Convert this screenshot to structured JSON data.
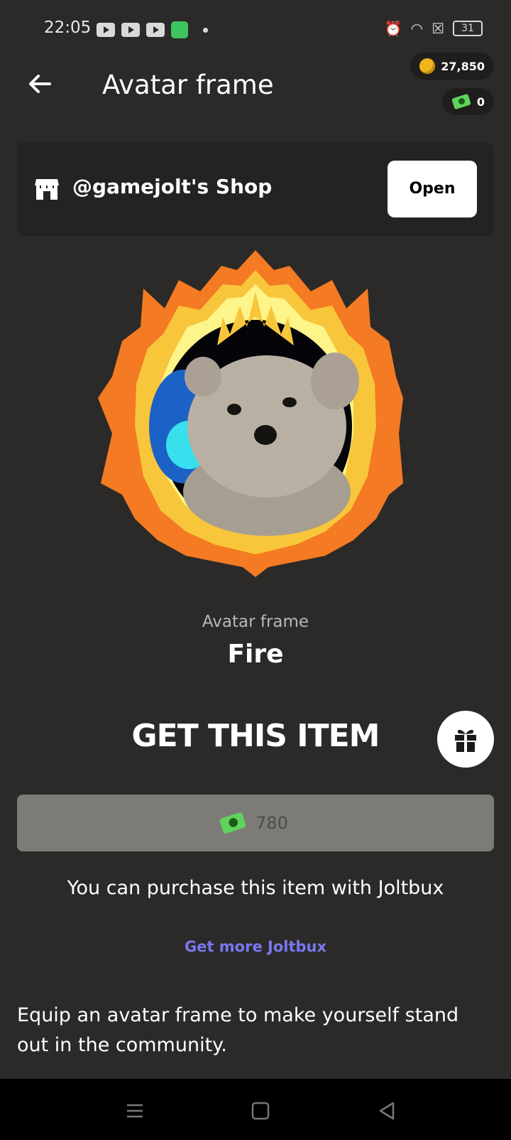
{
  "status_bar": {
    "time": "22:05",
    "battery": "31"
  },
  "header": {
    "title": "Avatar frame",
    "coins": "27,850",
    "joltbux": "0"
  },
  "shop": {
    "name": "@gamejolt's Shop",
    "open_label": "Open"
  },
  "item": {
    "type": "Avatar frame",
    "name": "Fire"
  },
  "purchase": {
    "heading": "GET THIS ITEM",
    "price": "780",
    "note": "You can purchase this item with Joltbux",
    "more_link": "Get more Joltbux"
  },
  "description": "Equip an avatar frame to make yourself stand out in the community.",
  "colors": {
    "background": "#2b2a28",
    "card": "#242321",
    "link": "#7a76f0",
    "disabled_button": "#7c7b78"
  }
}
